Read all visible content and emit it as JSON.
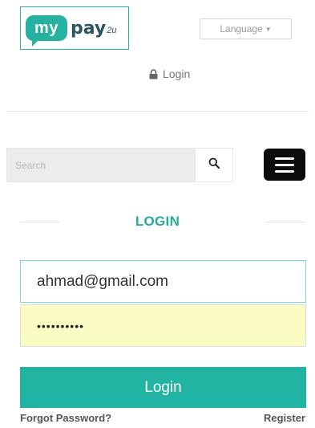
{
  "header": {
    "logo": {
      "bubble_text": "my",
      "text": "pay",
      "suffix": "2u"
    },
    "language": {
      "label": "Language",
      "icon": "caret-down-icon"
    },
    "top_login": {
      "label": "Login",
      "icon": "lock-icon"
    }
  },
  "search": {
    "placeholder": "Search",
    "value": "",
    "button_icon": "search-icon"
  },
  "menu": {
    "icon": "hamburger-menu-icon"
  },
  "login_form": {
    "title": "LOGIN",
    "email_value": "ahmad@gmail.com",
    "password_value": "••••••••••",
    "submit_label": "Login",
    "forgot_label": "Forgot Password?",
    "register_label": "Register"
  },
  "colors": {
    "accent": "#21b4a3",
    "title": "#27ab98",
    "autofill_bg": "#fbfbc4",
    "menu_bg": "#0c0c0c"
  }
}
